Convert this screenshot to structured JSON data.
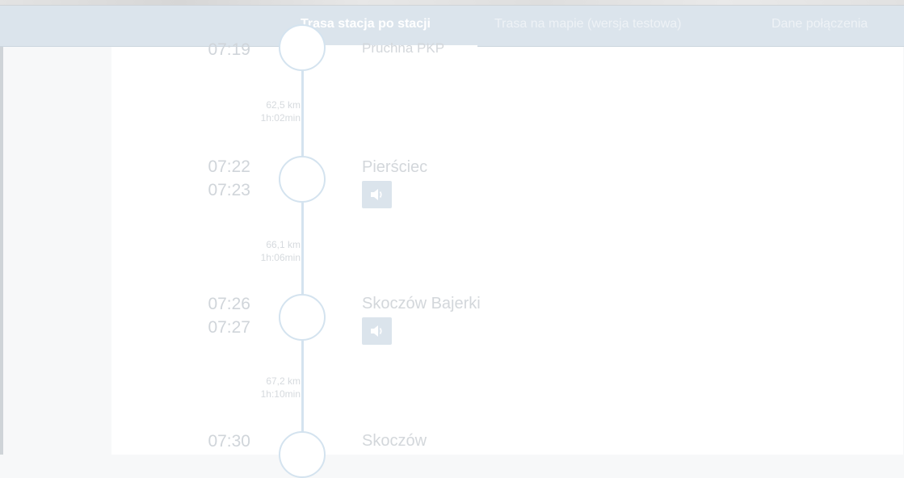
{
  "tabs": [
    {
      "label": "Trasa stacja po stacji",
      "active": true
    },
    {
      "label": "Trasa na mapie (wersja testowa)",
      "active": false
    },
    {
      "label": "Dane połączenia",
      "active": false
    }
  ],
  "stops_partial_top": {
    "time": "07:19",
    "station": "Pruchna PKP"
  },
  "segments": [
    {
      "distance": "62,5 km",
      "duration": "1h:02min"
    },
    {
      "distance": "66,1 km",
      "duration": "1h:06min"
    },
    {
      "distance": "67,2 km",
      "duration": "1h:10min"
    }
  ],
  "stops": [
    {
      "arrival": "07:22",
      "departure": "07:23",
      "station": "Pierściec"
    },
    {
      "arrival": "07:26",
      "departure": "07:27",
      "station": "Skoczów Bajerki"
    },
    {
      "arrival": "07:30",
      "departure": "",
      "station": "Skoczów"
    }
  ],
  "icons": {
    "sound": "speaker-icon"
  },
  "colors": {
    "nav_bg": "#dbe4ec",
    "timeline": "#d4e3ef",
    "text_faded": "#d0d5da"
  }
}
